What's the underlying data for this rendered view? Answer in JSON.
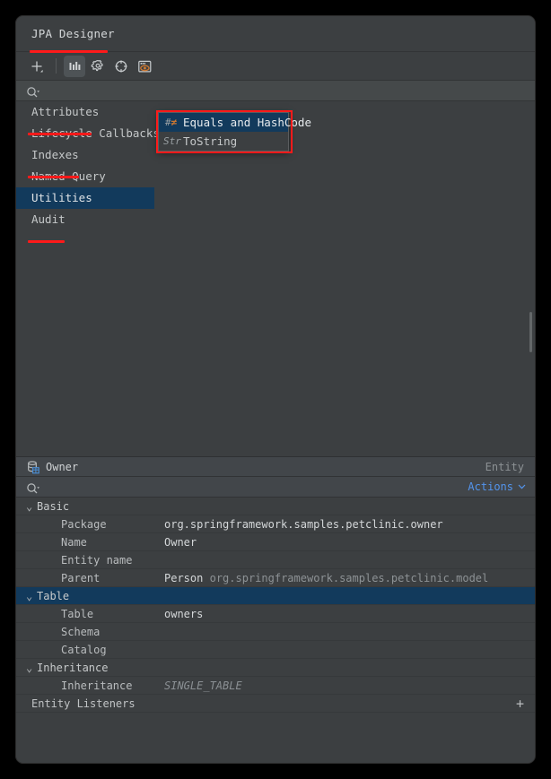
{
  "window": {
    "title": "JPA Designer"
  },
  "toolbar": {
    "items": [
      {
        "name": "add-icon",
        "glyph": "+",
        "active": false
      },
      {
        "name": "columns-icon",
        "glyph": "columns",
        "active": true
      },
      {
        "name": "gear-icon",
        "glyph": "gear",
        "active": false
      },
      {
        "name": "target-icon",
        "glyph": "target",
        "active": false
      },
      {
        "name": "preview-icon",
        "glyph": "preview",
        "active": false
      }
    ]
  },
  "search": {
    "placeholder": "",
    "value": "",
    "icon": "search-icon"
  },
  "sidebar": {
    "items": [
      {
        "label": "Attributes",
        "selected": false,
        "annotated": true
      },
      {
        "label": "Lifecycle Callbacks",
        "selected": false,
        "annotated": false
      },
      {
        "label": "Indexes",
        "selected": false,
        "annotated": true
      },
      {
        "label": "Named Query",
        "selected": false,
        "annotated": false
      },
      {
        "label": "Utilities",
        "selected": true,
        "annotated": false
      },
      {
        "label": "Audit",
        "selected": false,
        "annotated": true
      }
    ]
  },
  "popup": {
    "items": [
      {
        "icon_text": "#",
        "icon_accent": "≠",
        "label": "Equals and HashCode",
        "selected": true
      },
      {
        "icon_text": "Str",
        "icon_accent": "",
        "label": "ToString",
        "selected": false
      }
    ]
  },
  "details": {
    "header": {
      "title": "Owner",
      "kind": "Entity",
      "icon": "entity-icon"
    },
    "search": {
      "placeholder": "",
      "value": ""
    },
    "actions_label": "Actions",
    "groups": [
      {
        "label": "Basic",
        "selected": false,
        "expanded": true,
        "rows": [
          {
            "name": "Package",
            "value": "org.springframework.samples.petclinic.owner",
            "dim": "",
            "placeholder": false
          },
          {
            "name": "Name",
            "value": "Owner",
            "dim": "",
            "placeholder": false
          },
          {
            "name": "Entity name",
            "value": "",
            "dim": "",
            "placeholder": false
          },
          {
            "name": "Parent",
            "value": "Person",
            "dim": "org.springframework.samples.petclinic.model",
            "placeholder": false
          }
        ]
      },
      {
        "label": "Table",
        "selected": true,
        "expanded": true,
        "rows": [
          {
            "name": "Table",
            "value": "owners",
            "dim": "",
            "placeholder": false
          },
          {
            "name": "Schema",
            "value": "",
            "dim": "",
            "placeholder": false
          },
          {
            "name": "Catalog",
            "value": "",
            "dim": "",
            "placeholder": false
          }
        ]
      },
      {
        "label": "Inheritance",
        "selected": false,
        "expanded": true,
        "rows": [
          {
            "name": "Inheritance",
            "value": "SINGLE_TABLE",
            "dim": "",
            "placeholder": true
          }
        ]
      }
    ],
    "entity_listeners": {
      "label": "Entity Listeners",
      "add_glyph": "+"
    }
  },
  "colors": {
    "panel_bg": "#3c3f41",
    "selection_blue": "#123a5c",
    "accent_link": "#5394ec",
    "annotation_red": "#ff1a1a",
    "icon_orange": "#cc7832"
  }
}
